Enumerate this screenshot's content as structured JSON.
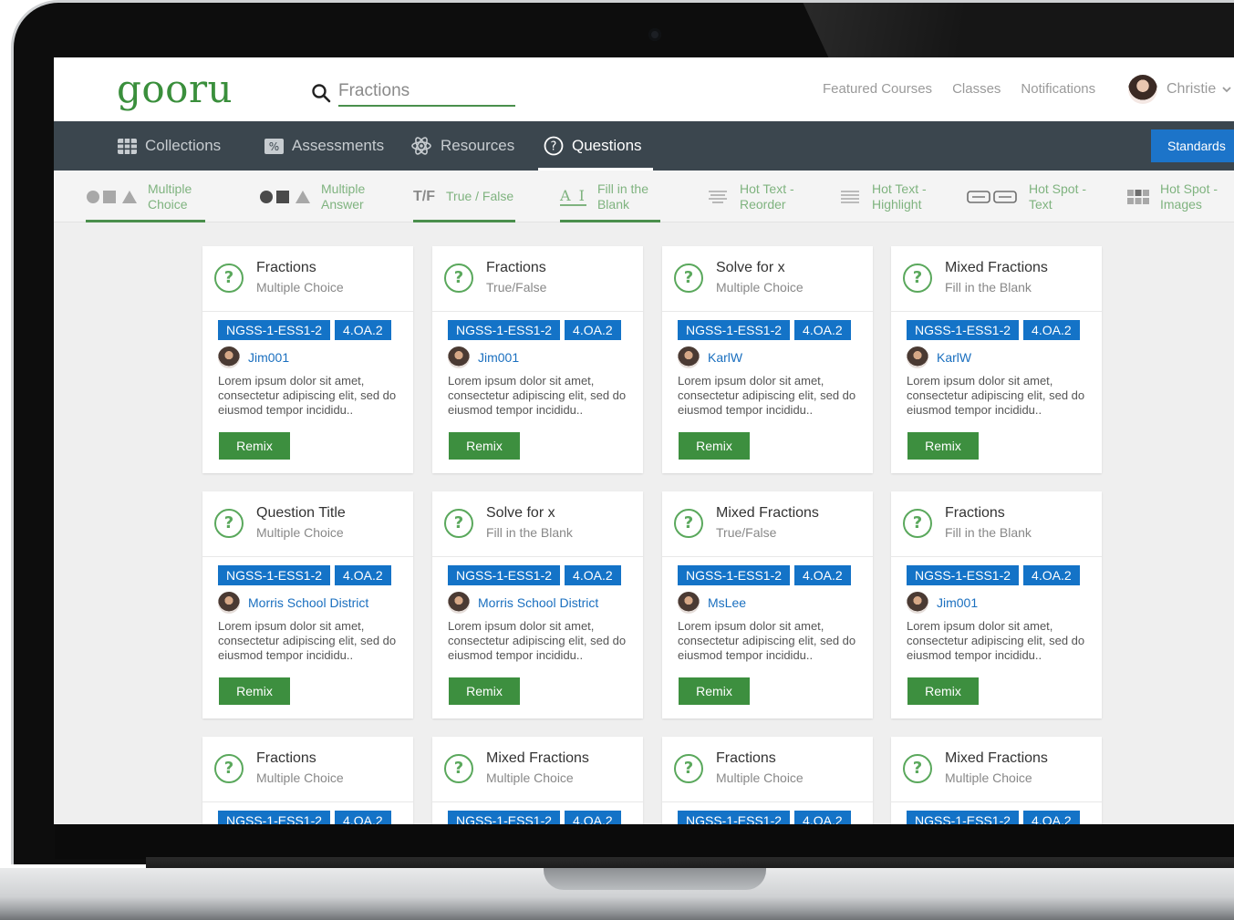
{
  "app": {
    "logo": "gooru"
  },
  "search": {
    "value": "Fractions"
  },
  "top_nav": [
    "Featured Courses",
    "Classes",
    "Notifications"
  ],
  "user": {
    "name": "Christie"
  },
  "dark_nav": {
    "items": [
      "Collections",
      "Assessments",
      "Resources",
      "Questions"
    ],
    "active": "Questions",
    "standards_label": "Standards"
  },
  "question_types": [
    {
      "label": "Multiple\nChoice",
      "line1": "Multiple",
      "line2": "Choice"
    },
    {
      "line1": "Multiple",
      "line2": "Answer"
    },
    {
      "line1": "True / False",
      "line2": "",
      "glyph": "T/F"
    },
    {
      "line1": "Fill in the",
      "line2": "Blank",
      "glyph": "A I"
    },
    {
      "line1": "Hot Text -",
      "line2": "Reorder"
    },
    {
      "line1": "Hot Text -",
      "line2": "Highlight"
    },
    {
      "line1": "Hot Spot -",
      "line2": "Text"
    },
    {
      "line1": "Hot Spot -",
      "line2": "Images"
    }
  ],
  "tags": [
    "NGSS-1-ESS1-2",
    "4.OA.2"
  ],
  "description": "Lorem ipsum dolor sit amet, consectetur adipiscing elit, sed do eiusmod tempor incididu..",
  "remix_label": "Remix",
  "cards": [
    {
      "title": "Fractions",
      "type": "Multiple Choice",
      "author": "Jim001"
    },
    {
      "title": "Fractions",
      "type": "True/False",
      "author": "Jim001"
    },
    {
      "title": "Solve for x",
      "type": "Multiple Choice",
      "author": "KarlW"
    },
    {
      "title": "Mixed Fractions",
      "type": "Fill in the Blank",
      "author": "KarlW"
    },
    {
      "title": "Question Title",
      "type": "Multiple Choice",
      "author": "Morris School District"
    },
    {
      "title": "Solve for x",
      "type": "Fill in the Blank",
      "author": "Morris School District"
    },
    {
      "title": "Mixed Fractions",
      "type": "True/False",
      "author": "MsLee"
    },
    {
      "title": "Fractions",
      "type": "Fill in the Blank",
      "author": "Jim001"
    },
    {
      "title": "Fractions",
      "type": "Multiple Choice",
      "author": ""
    },
    {
      "title": "Mixed Fractions",
      "type": "Multiple Choice",
      "author": ""
    },
    {
      "title": "Fractions",
      "type": "Multiple Choice",
      "author": ""
    },
    {
      "title": "Mixed Fractions",
      "type": "Multiple Choice",
      "author": ""
    }
  ],
  "colors": {
    "brand_green": "#3a8f3c",
    "tag_blue": "#1473c7",
    "nav_dark": "#3b464e",
    "standards_blue": "#1c74c9"
  },
  "icons": [
    "search-icon",
    "chevron-down-icon",
    "grid-icon",
    "percent-icon",
    "atom-icon",
    "question-circle-icon"
  ]
}
